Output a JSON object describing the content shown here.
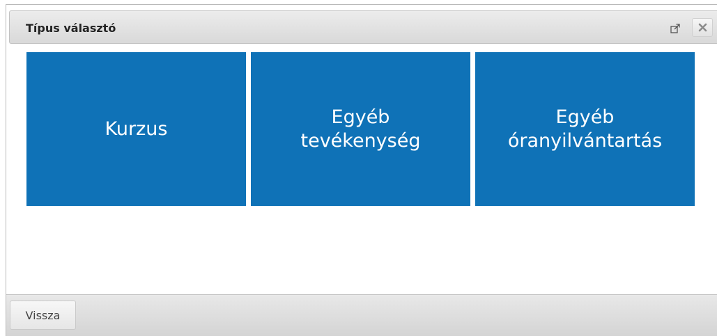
{
  "dialog": {
    "title": "Típus választó",
    "popout_icon": "external-link-icon",
    "close_icon": "close-icon"
  },
  "tiles": [
    {
      "label": "Kurzus"
    },
    {
      "label": "Egyéb\ntevékenység"
    },
    {
      "label": "Egyéb\nóranyilvántartás"
    }
  ],
  "footer": {
    "back_label": "Vissza"
  },
  "colors": {
    "tile_background": "#0f72b7",
    "tile_text": "#ffffff"
  }
}
